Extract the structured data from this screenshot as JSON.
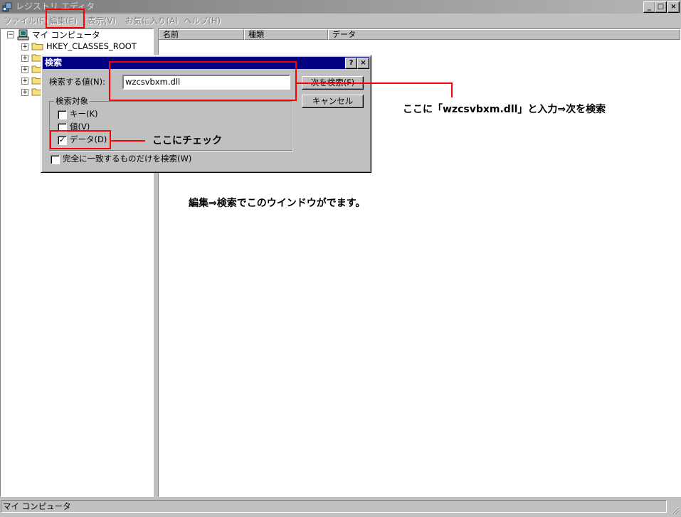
{
  "window": {
    "title": "レジストリ エディタ",
    "controls": {
      "minimize": "_",
      "maximize": "□",
      "close": "×"
    }
  },
  "menu": {
    "items": [
      "ファイル(F)",
      "編集(E)",
      "表示(V)",
      "お気に入り(A)",
      "ヘルプ(H)"
    ]
  },
  "tree": {
    "root": "マイ コンピュータ",
    "root_expander": "−",
    "child_expander": "+",
    "first_key": "HKEY_CLASSES_ROOT"
  },
  "list": {
    "columns": [
      "名前",
      "種類",
      "データ"
    ]
  },
  "dialog": {
    "title": "検索",
    "help_button": "?",
    "close_button": "×",
    "find_label": "検索する値(N):",
    "find_value": "wzcsvbxm.dll",
    "find_next_button": "次を検索(F)",
    "cancel_button": "キャンセル",
    "group_label": "検索対象",
    "options": [
      {
        "label": "キー(K)",
        "checked": false
      },
      {
        "label": "値(V)",
        "checked": false
      },
      {
        "label": "データ(D)",
        "checked": true
      }
    ],
    "check_mark": "✓",
    "match_whole_label": "完全に一致するものだけを検索(W)",
    "match_whole_checked": false
  },
  "annotations": {
    "enter_note": "ここに「wzcsvbxm.dll」と入力⇒次を検索",
    "check_note": "ここにチェック",
    "window_note": "編集⇒検索でこのウインドウがでます。"
  },
  "status": {
    "text": "マイ コンピュータ"
  },
  "colors": {
    "highlight": "#ff0000",
    "dialog_title": "#000080",
    "face": "#c0c0c0"
  }
}
